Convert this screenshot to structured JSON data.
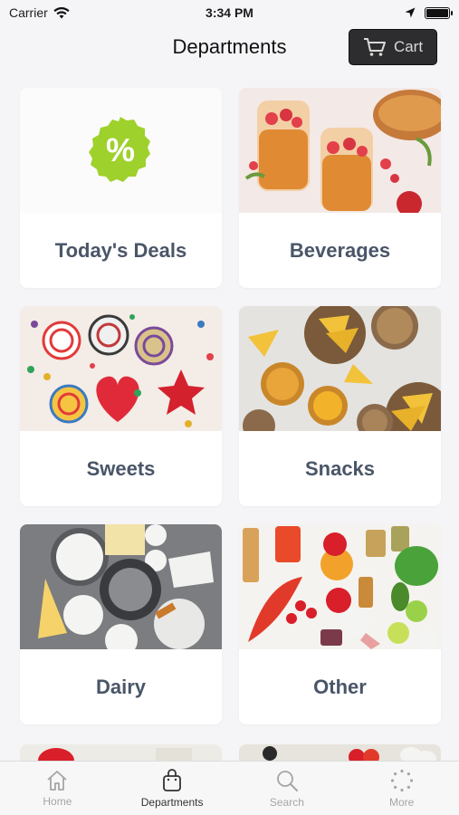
{
  "status": {
    "carrier": "Carrier",
    "time": "3:34 PM"
  },
  "header": {
    "title": "Departments",
    "cart_label": "Cart"
  },
  "departments": [
    {
      "label": "Today's Deals"
    },
    {
      "label": "Beverages"
    },
    {
      "label": "Sweets"
    },
    {
      "label": "Snacks"
    },
    {
      "label": "Dairy"
    },
    {
      "label": "Other"
    }
  ],
  "deals_badge": {
    "symbol": "%",
    "color": "#9ed12c"
  },
  "tabs": [
    {
      "label": "Home",
      "icon": "home-icon",
      "active": false
    },
    {
      "label": "Departments",
      "icon": "bag-icon",
      "active": true
    },
    {
      "label": "Search",
      "icon": "search-icon",
      "active": false
    },
    {
      "label": "More",
      "icon": "more-icon",
      "active": false
    }
  ],
  "colors": {
    "tab_active": "#333333",
    "tab_inactive": "#a5a5a5",
    "label": "#4a5568",
    "cart_bg": "#2d2d2f"
  }
}
